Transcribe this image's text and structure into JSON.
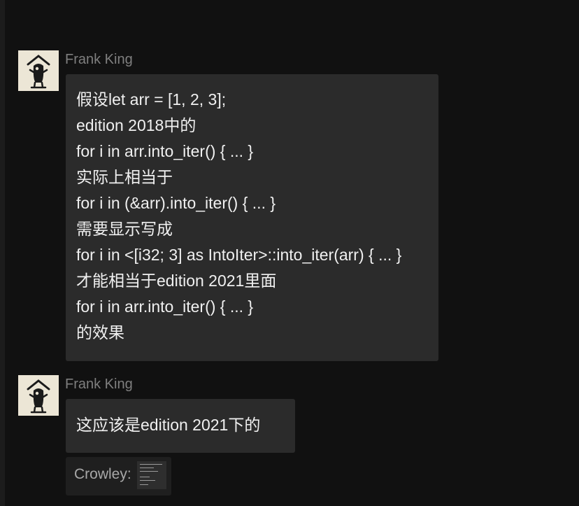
{
  "messages": [
    {
      "sender": "Frank King",
      "avatar_icon": "figure-avatar-icon",
      "lines": [
        "假设let arr = [1, 2, 3];",
        "edition 2018中的",
        "for i in arr.into_iter() { ... }",
        "实际上相当于",
        "for i in (&arr).into_iter() { ... }",
        "需要显示写成",
        "for i in <[i32; 3] as IntoIter>::into_iter(arr) { ... }",
        "才能相当于edition 2021里面",
        "for i in arr.into_iter() { ... }",
        "的效果"
      ]
    },
    {
      "sender": "Frank King",
      "avatar_icon": "figure-avatar-icon",
      "lines": [
        "这应该是edition 2021下的"
      ],
      "quote": {
        "label": "Crowley:",
        "thumbnail_icon": "screenshot-thumbnail-icon"
      }
    }
  ],
  "colors": {
    "background": "#111111",
    "bubble": "#2b2b2b",
    "sender_name": "#7f7f7f",
    "message_text": "#f0f0f0"
  }
}
